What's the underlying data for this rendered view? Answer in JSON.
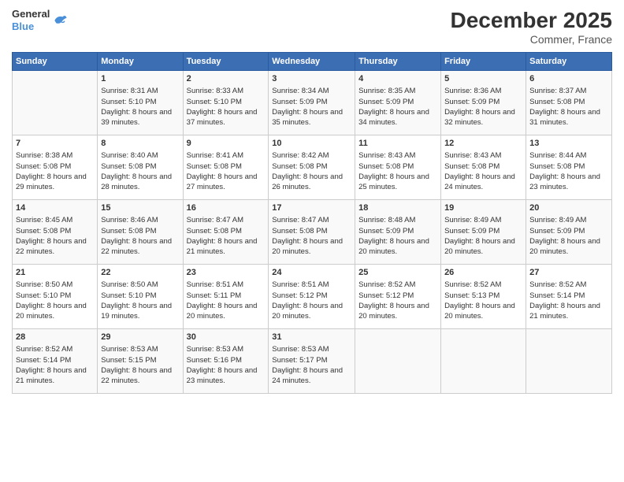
{
  "header": {
    "logo": {
      "general": "General",
      "blue": "Blue"
    },
    "title": "December 2025",
    "location": "Commer, France"
  },
  "weekdays": [
    "Sunday",
    "Monday",
    "Tuesday",
    "Wednesday",
    "Thursday",
    "Friday",
    "Saturday"
  ],
  "weeks": [
    [
      {
        "day": "",
        "sunrise": "",
        "sunset": "",
        "daylight": ""
      },
      {
        "day": "1",
        "sunrise": "Sunrise: 8:31 AM",
        "sunset": "Sunset: 5:10 PM",
        "daylight": "Daylight: 8 hours and 39 minutes."
      },
      {
        "day": "2",
        "sunrise": "Sunrise: 8:33 AM",
        "sunset": "Sunset: 5:10 PM",
        "daylight": "Daylight: 8 hours and 37 minutes."
      },
      {
        "day": "3",
        "sunrise": "Sunrise: 8:34 AM",
        "sunset": "Sunset: 5:09 PM",
        "daylight": "Daylight: 8 hours and 35 minutes."
      },
      {
        "day": "4",
        "sunrise": "Sunrise: 8:35 AM",
        "sunset": "Sunset: 5:09 PM",
        "daylight": "Daylight: 8 hours and 34 minutes."
      },
      {
        "day": "5",
        "sunrise": "Sunrise: 8:36 AM",
        "sunset": "Sunset: 5:09 PM",
        "daylight": "Daylight: 8 hours and 32 minutes."
      },
      {
        "day": "6",
        "sunrise": "Sunrise: 8:37 AM",
        "sunset": "Sunset: 5:08 PM",
        "daylight": "Daylight: 8 hours and 31 minutes."
      }
    ],
    [
      {
        "day": "7",
        "sunrise": "Sunrise: 8:38 AM",
        "sunset": "Sunset: 5:08 PM",
        "daylight": "Daylight: 8 hours and 29 minutes."
      },
      {
        "day": "8",
        "sunrise": "Sunrise: 8:40 AM",
        "sunset": "Sunset: 5:08 PM",
        "daylight": "Daylight: 8 hours and 28 minutes."
      },
      {
        "day": "9",
        "sunrise": "Sunrise: 8:41 AM",
        "sunset": "Sunset: 5:08 PM",
        "daylight": "Daylight: 8 hours and 27 minutes."
      },
      {
        "day": "10",
        "sunrise": "Sunrise: 8:42 AM",
        "sunset": "Sunset: 5:08 PM",
        "daylight": "Daylight: 8 hours and 26 minutes."
      },
      {
        "day": "11",
        "sunrise": "Sunrise: 8:43 AM",
        "sunset": "Sunset: 5:08 PM",
        "daylight": "Daylight: 8 hours and 25 minutes."
      },
      {
        "day": "12",
        "sunrise": "Sunrise: 8:43 AM",
        "sunset": "Sunset: 5:08 PM",
        "daylight": "Daylight: 8 hours and 24 minutes."
      },
      {
        "day": "13",
        "sunrise": "Sunrise: 8:44 AM",
        "sunset": "Sunset: 5:08 PM",
        "daylight": "Daylight: 8 hours and 23 minutes."
      }
    ],
    [
      {
        "day": "14",
        "sunrise": "Sunrise: 8:45 AM",
        "sunset": "Sunset: 5:08 PM",
        "daylight": "Daylight: 8 hours and 22 minutes."
      },
      {
        "day": "15",
        "sunrise": "Sunrise: 8:46 AM",
        "sunset": "Sunset: 5:08 PM",
        "daylight": "Daylight: 8 hours and 22 minutes."
      },
      {
        "day": "16",
        "sunrise": "Sunrise: 8:47 AM",
        "sunset": "Sunset: 5:08 PM",
        "daylight": "Daylight: 8 hours and 21 minutes."
      },
      {
        "day": "17",
        "sunrise": "Sunrise: 8:47 AM",
        "sunset": "Sunset: 5:08 PM",
        "daylight": "Daylight: 8 hours and 20 minutes."
      },
      {
        "day": "18",
        "sunrise": "Sunrise: 8:48 AM",
        "sunset": "Sunset: 5:09 PM",
        "daylight": "Daylight: 8 hours and 20 minutes."
      },
      {
        "day": "19",
        "sunrise": "Sunrise: 8:49 AM",
        "sunset": "Sunset: 5:09 PM",
        "daylight": "Daylight: 8 hours and 20 minutes."
      },
      {
        "day": "20",
        "sunrise": "Sunrise: 8:49 AM",
        "sunset": "Sunset: 5:09 PM",
        "daylight": "Daylight: 8 hours and 20 minutes."
      }
    ],
    [
      {
        "day": "21",
        "sunrise": "Sunrise: 8:50 AM",
        "sunset": "Sunset: 5:10 PM",
        "daylight": "Daylight: 8 hours and 20 minutes."
      },
      {
        "day": "22",
        "sunrise": "Sunrise: 8:50 AM",
        "sunset": "Sunset: 5:10 PM",
        "daylight": "Daylight: 8 hours and 19 minutes."
      },
      {
        "day": "23",
        "sunrise": "Sunrise: 8:51 AM",
        "sunset": "Sunset: 5:11 PM",
        "daylight": "Daylight: 8 hours and 20 minutes."
      },
      {
        "day": "24",
        "sunrise": "Sunrise: 8:51 AM",
        "sunset": "Sunset: 5:12 PM",
        "daylight": "Daylight: 8 hours and 20 minutes."
      },
      {
        "day": "25",
        "sunrise": "Sunrise: 8:52 AM",
        "sunset": "Sunset: 5:12 PM",
        "daylight": "Daylight: 8 hours and 20 minutes."
      },
      {
        "day": "26",
        "sunrise": "Sunrise: 8:52 AM",
        "sunset": "Sunset: 5:13 PM",
        "daylight": "Daylight: 8 hours and 20 minutes."
      },
      {
        "day": "27",
        "sunrise": "Sunrise: 8:52 AM",
        "sunset": "Sunset: 5:14 PM",
        "daylight": "Daylight: 8 hours and 21 minutes."
      }
    ],
    [
      {
        "day": "28",
        "sunrise": "Sunrise: 8:52 AM",
        "sunset": "Sunset: 5:14 PM",
        "daylight": "Daylight: 8 hours and 21 minutes."
      },
      {
        "day": "29",
        "sunrise": "Sunrise: 8:53 AM",
        "sunset": "Sunset: 5:15 PM",
        "daylight": "Daylight: 8 hours and 22 minutes."
      },
      {
        "day": "30",
        "sunrise": "Sunrise: 8:53 AM",
        "sunset": "Sunset: 5:16 PM",
        "daylight": "Daylight: 8 hours and 23 minutes."
      },
      {
        "day": "31",
        "sunrise": "Sunrise: 8:53 AM",
        "sunset": "Sunset: 5:17 PM",
        "daylight": "Daylight: 8 hours and 24 minutes."
      },
      {
        "day": "",
        "sunrise": "",
        "sunset": "",
        "daylight": ""
      },
      {
        "day": "",
        "sunrise": "",
        "sunset": "",
        "daylight": ""
      },
      {
        "day": "",
        "sunrise": "",
        "sunset": "",
        "daylight": ""
      }
    ]
  ]
}
